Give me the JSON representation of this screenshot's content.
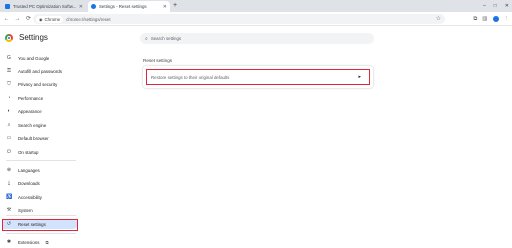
{
  "browser": {
    "tabs": [
      {
        "title": "Trusted PC Optimization Softw...",
        "favicon_color": "#1a73e8",
        "active": false
      },
      {
        "title": "Settings - Reset settings",
        "favicon_color": "#1a73e8",
        "active": true
      }
    ],
    "new_tab_icon": "+",
    "window_controls": [
      "–",
      "□",
      "✕"
    ],
    "chip_label": "Chrome",
    "url": "chrome://settings/reset",
    "nav": {
      "back": "←",
      "forward": "→",
      "reload": "⟳"
    }
  },
  "header": {
    "title": "Settings",
    "search_placeholder": "Search settings"
  },
  "sidebar": {
    "items": [
      {
        "label": "You and Google",
        "icon": "google-icon",
        "glyph": "G"
      },
      {
        "label": "Autofill and passwords",
        "icon": "key-icon",
        "glyph": "⚿"
      },
      {
        "label": "Privacy and security",
        "icon": "shield-icon",
        "glyph": "⛉"
      },
      {
        "label": "Performance",
        "icon": "speedometer-icon",
        "glyph": "◔"
      },
      {
        "label": "Appearance",
        "icon": "palette-icon",
        "glyph": "◐"
      },
      {
        "label": "Search engine",
        "icon": "search-icon",
        "glyph": "⌕"
      },
      {
        "label": "Default browser",
        "icon": "browser-icon",
        "glyph": "▭"
      },
      {
        "label": "On startup",
        "icon": "power-icon",
        "glyph": "⏻"
      },
      {
        "label": "Languages",
        "icon": "globe-icon",
        "glyph": "⊕"
      },
      {
        "label": "Downloads",
        "icon": "download-icon",
        "glyph": "⤓"
      },
      {
        "label": "Accessibility",
        "icon": "accessibility-icon",
        "glyph": "♿"
      },
      {
        "label": "System",
        "icon": "wrench-icon",
        "glyph": "⚒"
      },
      {
        "label": "Reset settings",
        "icon": "reset-icon",
        "glyph": "↺",
        "selected": true
      },
      {
        "label": "Extensions",
        "icon": "puzzle-icon",
        "glyph": "✱",
        "external": "⧉"
      }
    ]
  },
  "main": {
    "section_title": "Reset settings",
    "reset_row_label": "Restore settings to their original defaults",
    "reset_row_arrow": "▸"
  },
  "colors": {
    "highlight_red": "#e0263b",
    "selected_bg": "#d3e3fd",
    "accent_blue": "#1a73e8"
  }
}
